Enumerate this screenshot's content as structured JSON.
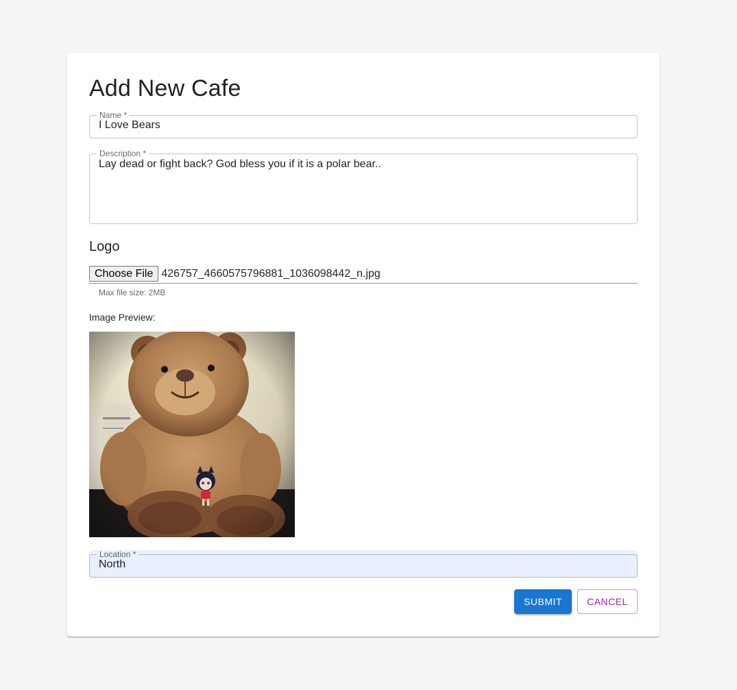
{
  "form": {
    "title": "Add New Cafe",
    "name": {
      "label": "Name *",
      "value": "I Love Bears"
    },
    "description": {
      "label": "Description *",
      "value": "Lay dead or fight back? God bless you if it is a polar bear.."
    },
    "logo": {
      "heading": "Logo",
      "choose_file_label": "Choose File",
      "file_name": "426757_4660575796881_1036098442_n.jpg",
      "helper": "Max file size: 2MB",
      "preview_label": "Image Preview:"
    },
    "location": {
      "label": "Location *",
      "value": "North"
    },
    "actions": {
      "submit": "SUBMIT",
      "cancel": "CANCEL"
    }
  },
  "colors": {
    "background": "#f5f5f5",
    "primary": "#1976d2",
    "secondary": "#9c27b0",
    "autofill": "#e8f0fe"
  }
}
